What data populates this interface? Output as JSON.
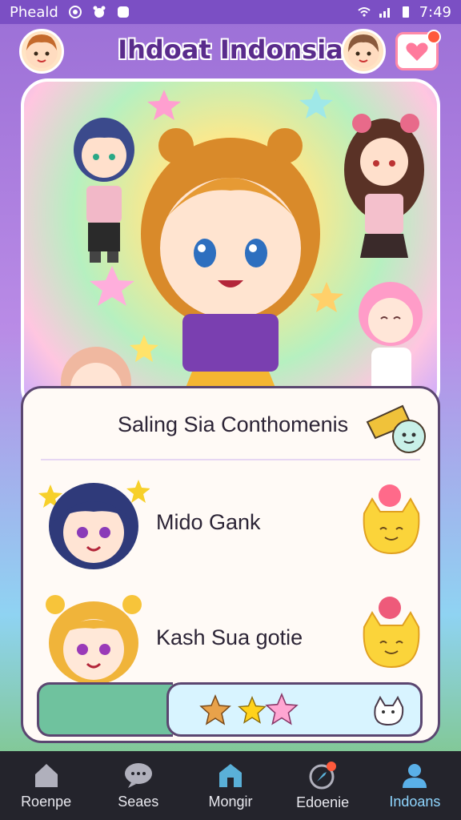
{
  "status_bar": {
    "app_label": "Pheald",
    "time": "7:49",
    "icons": [
      "record-icon",
      "bear-icon",
      "app-icon",
      "wifi-icon",
      "signal-icon",
      "battery-icon"
    ]
  },
  "header": {
    "title": "Ihdoat Indonsia",
    "left_avatar": "avatar-girl-left",
    "right_avatar": "avatar-girl-right",
    "notification_icon": "heart-message-icon"
  },
  "list": {
    "items": [
      {
        "label": "Saling Sia Conthomenis",
        "icon": "rain-candy-icon"
      },
      {
        "label": "Mido Gank",
        "icon": "cat-sticker-icon"
      },
      {
        "label": "Kash Sua gotie",
        "icon": "cat-sticker-icon"
      }
    ]
  },
  "tray": {
    "stickers": [
      "cookie-star-icon",
      "yellow-star-icon",
      "pink-star-icon",
      "cat-sticker-icon"
    ]
  },
  "nav": {
    "items": [
      {
        "label": "Roenpe",
        "icon": "home-icon"
      },
      {
        "label": "Seaes",
        "icon": "chat-icon"
      },
      {
        "label": "Mongir",
        "icon": "store-icon"
      },
      {
        "label": "Edoenie",
        "icon": "compass-icon"
      },
      {
        "label": "Indoans",
        "icon": "profile-icon"
      }
    ],
    "active_index": 4
  },
  "colors": {
    "accent": "#7b4fc4",
    "title": "#5a2c8c",
    "card_border": "#5b4670",
    "nav_bg": "#24242c",
    "nav_active": "#8fd6ff"
  }
}
